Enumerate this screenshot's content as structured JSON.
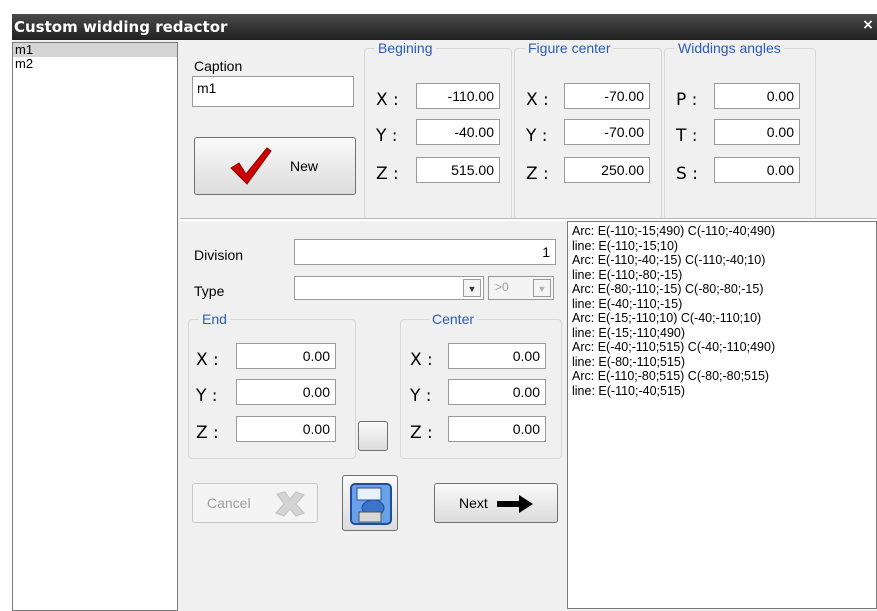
{
  "window": {
    "title": "Custom widding redactor",
    "close_glyph": "×"
  },
  "list": {
    "items": [
      {
        "label": "m1",
        "selected": true
      },
      {
        "label": "m2",
        "selected": false
      }
    ]
  },
  "caption": {
    "label": "Caption",
    "value": "m1"
  },
  "new_button": {
    "label": "New",
    "icon": "checkmark-icon",
    "icon_color": "#cc0000"
  },
  "begining": {
    "legend": "Begining",
    "x_label": "X :",
    "y_label": "Y :",
    "z_label": "Z :",
    "x": "-110.00",
    "y": "-40.00",
    "z": "515.00"
  },
  "figure_center": {
    "legend": "Figure center",
    "x_label": "X :",
    "y_label": "Y :",
    "z_label": "Z :",
    "x": "-70.00",
    "y": "-70.00",
    "z": "250.00"
  },
  "angles": {
    "legend": "Widdings angles",
    "p_label": "P :",
    "t_label": "T :",
    "s_label": "S :",
    "p": "0.00",
    "t": "0.00",
    "s": "0.00"
  },
  "division": {
    "label": "Division",
    "value": "1"
  },
  "type": {
    "label": "Type",
    "value": "",
    "filter_value": ">0"
  },
  "end": {
    "legend": "End",
    "x_label": "X :",
    "y_label": "Y :",
    "z_label": "Z :",
    "x": "0.00",
    "y": "0.00",
    "z": "0.00"
  },
  "center": {
    "legend": "Center",
    "x_label": "X :",
    "y_label": "Y :",
    "z_label": "Z :",
    "x": "0.00",
    "y": "0.00",
    "z": "0.00"
  },
  "cancel_button": {
    "label": "Cancel",
    "icon": "x-icon",
    "enabled": false
  },
  "save_button": {
    "icon": "save-icon"
  },
  "next_button": {
    "label": "Next",
    "icon": "arrow-right-icon"
  },
  "log": [
    "Arc: E(-110;-15;490) C(-110;-40;490)",
    "line: E(-110;-15;10)",
    "Arc: E(-110;-40;-15) C(-110;-40;10)",
    "line: E(-110;-80;-15)",
    "Arc: E(-80;-110;-15) C(-80;-80;-15)",
    "line: E(-40;-110;-15)",
    "Arc: E(-15;-110;10) C(-40;-110;10)",
    "line: E(-15;-110;490)",
    "Arc: E(-40;-110;515) C(-40;-110;490)",
    "line: E(-80;-110;515)",
    "Arc: E(-110;-80;515) C(-80;-80;515)",
    "line: E(-110;-40;515)"
  ]
}
